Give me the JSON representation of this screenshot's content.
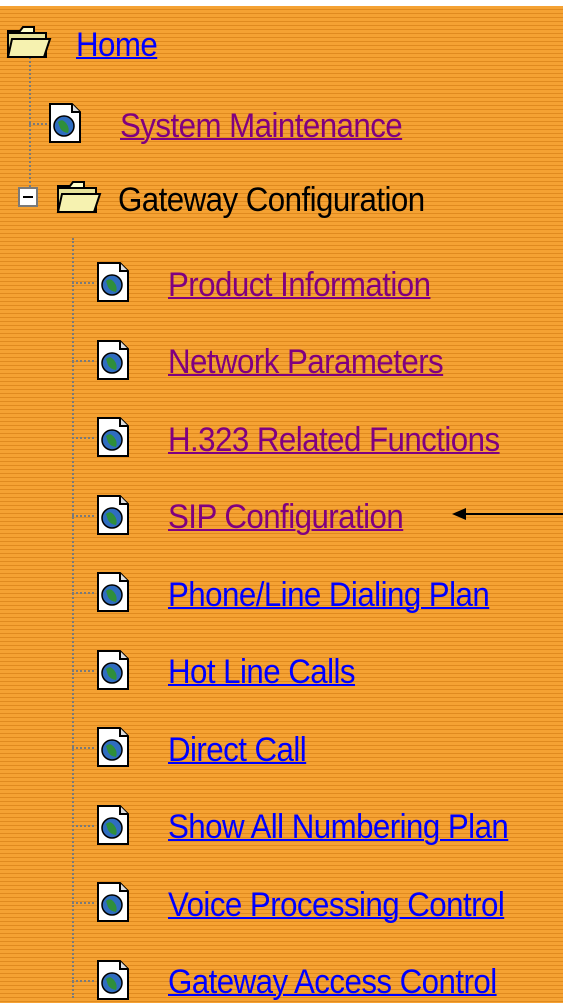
{
  "tree": {
    "root": {
      "label": "Home",
      "icon": "open-folder-icon"
    },
    "system_maintenance": {
      "label": "System Maintenance",
      "icon": "document-globe-icon"
    },
    "gateway_configuration": {
      "label": "Gateway Configuration",
      "icon": "open-folder-icon",
      "expander": "minus",
      "children": [
        {
          "label": "Product Information",
          "state": "visited"
        },
        {
          "label": "Network Parameters",
          "state": "visited"
        },
        {
          "label": "H.323 Related Functions",
          "state": "visited"
        },
        {
          "label": "SIP Configuration",
          "state": "visited",
          "annotated": true
        },
        {
          "label": "Phone/Line Dialing Plan",
          "state": "unvisited"
        },
        {
          "label": "Hot Line Calls",
          "state": "unvisited"
        },
        {
          "label": "Direct Call",
          "state": "unvisited"
        },
        {
          "label": "Show All Numbering Plan",
          "state": "unvisited"
        },
        {
          "label": "Voice Processing Control",
          "state": "unvisited"
        },
        {
          "label": "Gateway Access Control",
          "state": "unvisited"
        }
      ]
    }
  },
  "colors": {
    "panel_orange": "#F39B24",
    "stripe_dark": "#E08A1F",
    "visited_link": "#800080",
    "unvisited_link": "#0000FF",
    "arrow": "#000000"
  }
}
